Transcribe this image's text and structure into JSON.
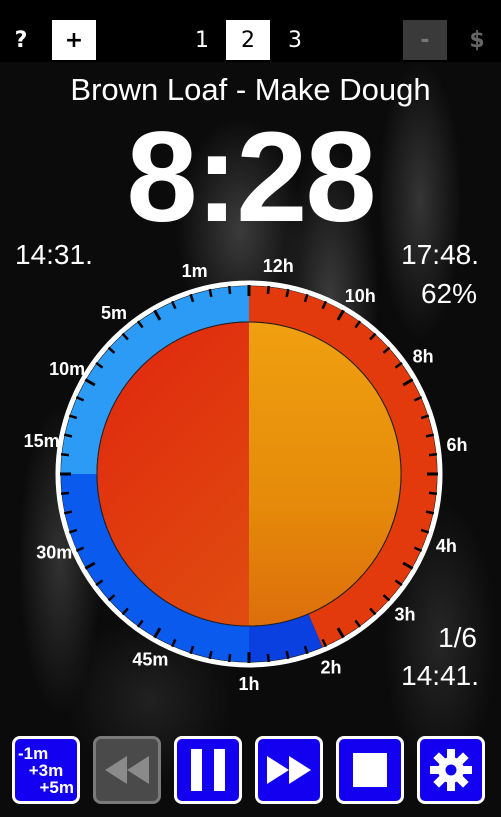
{
  "top_bar": {
    "help_label": "?",
    "add_label": "+",
    "tabs": [
      {
        "label": "1",
        "selected": false
      },
      {
        "label": "2",
        "selected": true
      },
      {
        "label": "3",
        "selected": false
      }
    ],
    "minus_label": "-",
    "dollar_label": "$"
  },
  "timer": {
    "title": "Brown Loaf - Make Dough",
    "remaining": "8:28",
    "start_time": "14:31.",
    "end_time": "17:48.",
    "percent": "62%",
    "step": "1/6",
    "step_end_time": "14:41."
  },
  "dial": {
    "left_labels": [
      "1m",
      "5m",
      "10m",
      "15m",
      "30m",
      "45m"
    ],
    "right_labels": [
      "12h",
      "10h",
      "8h",
      "6h",
      "4h",
      "3h",
      "2h",
      "1h"
    ],
    "inner_remaining_fraction": 0.83,
    "colors": {
      "light_blue": "#2b9bf5",
      "cyan": "#00e5ff",
      "blue": "#0a5aee",
      "dark_blue": "#0a3fe0",
      "red": "#e23a0c",
      "orange": "#e8940a",
      "inner_red": "#e24310"
    }
  },
  "bottom_bar": {
    "adjust_lines": [
      "-1m",
      "+3m",
      "+5m"
    ],
    "buttons": [
      "adjust",
      "rewind",
      "pause",
      "fast-forward",
      "stop",
      "settings"
    ]
  }
}
